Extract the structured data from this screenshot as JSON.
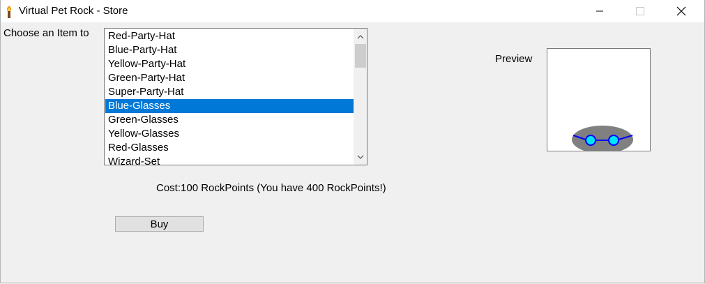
{
  "window": {
    "title": "Virtual Pet Rock - Store",
    "app_icon": "torch-icon",
    "controls": {
      "minimize": "minimize-icon",
      "maximize": "maximize-icon",
      "close": "close-icon"
    }
  },
  "store": {
    "choose_label": "Choose an Item to",
    "items": [
      {
        "label": "Red-Party-Hat",
        "selected": false
      },
      {
        "label": "Blue-Party-Hat",
        "selected": false
      },
      {
        "label": "Yellow-Party-Hat",
        "selected": false
      },
      {
        "label": "Green-Party-Hat",
        "selected": false
      },
      {
        "label": "Super-Party-Hat",
        "selected": false
      },
      {
        "label": "Blue-Glasses",
        "selected": true
      },
      {
        "label": "Green-Glasses",
        "selected": false
      },
      {
        "label": "Yellow-Glasses",
        "selected": false
      },
      {
        "label": "Red-Glasses",
        "selected": false
      },
      {
        "label": "Wizard-Set",
        "selected": false
      }
    ],
    "preview_label": "Preview",
    "cost_text": "Cost:100 RockPoints (You have 400 RockPoints!)",
    "buy_label": "Buy"
  },
  "colors": {
    "selection": "#0078d7",
    "rock": "#808080",
    "glasses_frame": "#0000ff",
    "glasses_lens": "#00e5ff"
  }
}
